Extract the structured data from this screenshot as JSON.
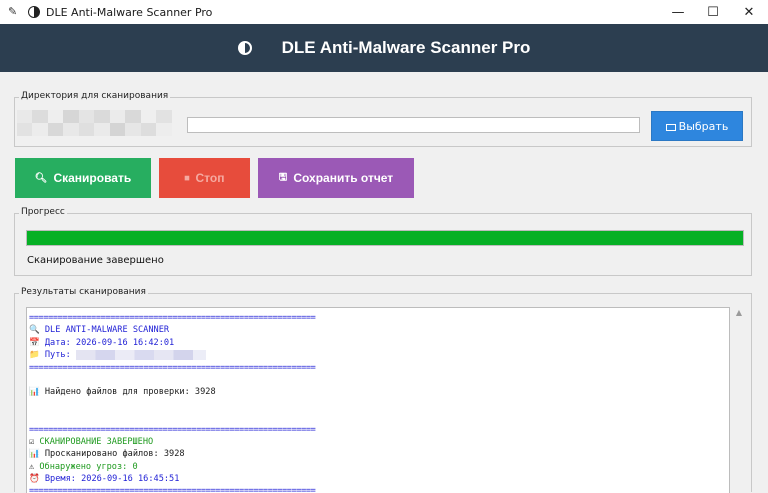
{
  "window": {
    "title": "DLE Anti-Malware Scanner Pro",
    "controls": {
      "minimize": "—",
      "maximize": "☐",
      "close": "✕"
    }
  },
  "header": {
    "title": "DLE Anti-Malware Scanner Pro",
    "icon": "half-moon-icon"
  },
  "directory": {
    "legend": "Директория для сканирования",
    "path_value": "",
    "browse_label": "Выбрать",
    "browse_icon": "folder-icon"
  },
  "actions": {
    "scan_label": "Сканировать",
    "scan_icon": "magnifier-icon",
    "stop_label": "Стоп",
    "stop_icon": "stop-icon",
    "save_label": "Сохранить отчет",
    "save_icon": "floppy-icon"
  },
  "progress": {
    "legend": "Прогресс",
    "value_percent": 100,
    "status": "Сканирование завершено"
  },
  "results": {
    "legend": "Результаты сканирования",
    "lines": [
      {
        "text": "============================================================",
        "color": "blue",
        "kind": "separator"
      },
      {
        "icon": "🔍",
        "text": "DLE ANTI-MALWARE SCANNER",
        "color": "blue"
      },
      {
        "icon": "📅",
        "text": "Дата: 2026-09-16 16:42:01",
        "color": "blue"
      },
      {
        "icon": "📁",
        "text": "Путь: ",
        "color": "blue",
        "blurred": true
      },
      {
        "text": "============================================================",
        "color": "blue",
        "kind": "separator"
      },
      {
        "text": "",
        "kind": "blank"
      },
      {
        "icon": "📊",
        "text": "Найдено файлов для проверки: 3928",
        "color": "dark"
      },
      {
        "text": "",
        "kind": "blank"
      },
      {
        "text": "",
        "kind": "blank"
      },
      {
        "text": "============================================================",
        "color": "blue",
        "kind": "separator"
      },
      {
        "icon": "☑",
        "text": "СКАНИРОВАНИЕ ЗАВЕРШЕНО",
        "color": "green"
      },
      {
        "icon": "📊",
        "text": "Просканировано файлов: 3928",
        "color": "dark"
      },
      {
        "icon": "⚠",
        "text": "Обнаружено угроз: 0",
        "color": "green"
      },
      {
        "icon": "⏰",
        "text": "Время: 2026-09-16 16:45:51",
        "color": "blue"
      },
      {
        "text": "============================================================",
        "color": "blue",
        "kind": "separator"
      }
    ]
  },
  "colors": {
    "header_bg": "#2c3e50",
    "scan": "#27ae60",
    "stop": "#e74c3c",
    "save": "#9b59b6",
    "browse": "#2e86de",
    "progress": "#06b025"
  }
}
